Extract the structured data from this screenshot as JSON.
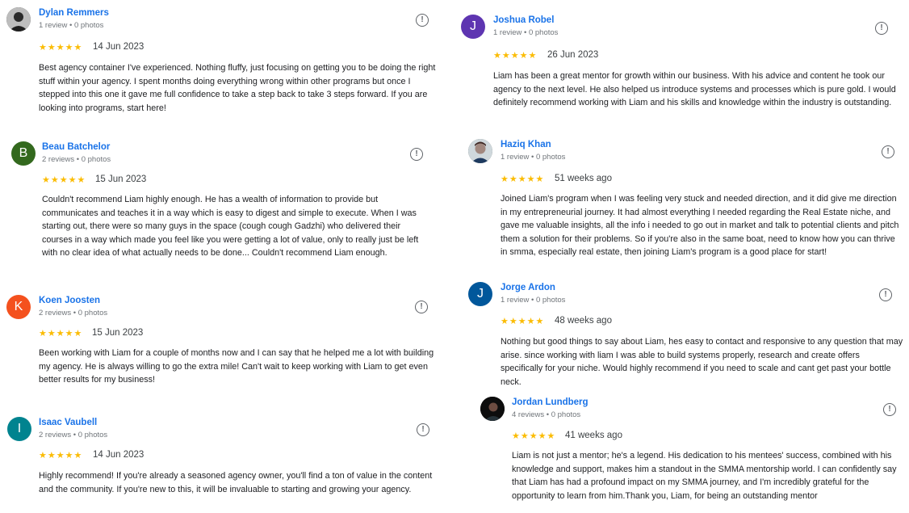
{
  "colors": {
    "link": "#1a73e8",
    "star": "#fbbc04",
    "meta": "#70757a"
  },
  "left": [
    {
      "name": "Dylan Remmers",
      "meta": "1 review • 0 photos",
      "initial": "",
      "avatar_color": "#4a4a4a",
      "rating": 5,
      "stars": "★★★★★",
      "date": "14 Jun 2023",
      "text": "Best agency container I've experienced. Nothing fluffy, just focusing on getting you to be doing the right stuff within your agency. I spent months doing everything wrong within other programs but once I stepped into this one it gave me full confidence to take a step back to take 3 steps forward. If you are looking into programs, start here!"
    },
    {
      "name": "Beau Batchelor",
      "meta": "2 reviews • 0 photos",
      "initial": "B",
      "avatar_color": "#33691e",
      "rating": 5,
      "stars": "★★★★★",
      "date": "15 Jun 2023",
      "text": "Couldn't recommend Liam highly enough. He has a wealth of information to provide but communicates and teaches it in a way which is easy to digest and simple to execute. When I was starting out, there were so many guys in the space (cough cough Gadzhi) who delivered their courses in a way which made you feel like you were getting a lot of value, only to really just be left with no clear idea of what actually needs to be done... Couldn't recommend Liam enough."
    },
    {
      "name": "Koen Joosten",
      "meta": "2 reviews • 0 photos",
      "initial": "K",
      "avatar_color": "#f4511e",
      "rating": 5,
      "stars": "★★★★★",
      "date": "15 Jun 2023",
      "text": "Been working with Liam for a couple of months now and I can say that he helped me a lot with building my agency. He is always willing to go the extra mile! Can't wait to keep working with Liam to get even better results for my business!"
    },
    {
      "name": "Isaac Vaubell",
      "meta": "2 reviews • 0 photos",
      "initial": "I",
      "avatar_color": "#00838f",
      "rating": 5,
      "stars": "★★★★★",
      "date": "14 Jun 2023",
      "text": "Highly recommend! If you're already a seasoned agency owner, you'll find a ton of value in the content and the community. If you're new to this, it will be invaluable to starting and growing your agency."
    }
  ],
  "right": [
    {
      "name": "Joshua Robel",
      "meta": "1 review • 0 photos",
      "initial": "J",
      "avatar_color": "#5e35b1",
      "rating": 5,
      "stars": "★★★★★",
      "date": "26 Jun 2023",
      "text": "Liam has been a great mentor for growth within our business. With his advice and content he took our agency to the next level. He also helped us introduce systems and processes which is pure gold. I would definitely recommend working with Liam and his skills and knowledge within the industry is outstanding."
    },
    {
      "name": "Haziq Khan",
      "meta": "1 review • 0 photos",
      "initial": "",
      "avatar_color": "#8d6e63",
      "rating": 5,
      "stars": "★★★★★",
      "date": "51 weeks ago",
      "text": "Joined Liam's program when I was feeling very stuck and needed direction, and it did give me direction in my entrepreneurial journey. It had almost everything I needed regarding the Real Estate niche, and gave me valuable insights, all the info i needed to go out in market and talk to potential clients and pitch them a solution for their problems. So if you're also in the same boat, need to know how you can thrive in smma, especially real estate, then joining Liam's program is a good place for start!"
    },
    {
      "name": "Jorge Ardon",
      "meta": "1 review • 0 photos",
      "initial": "J",
      "avatar_color": "#01579b",
      "rating": 5,
      "stars": "★★★★★",
      "date": "48 weeks ago",
      "text": "Nothing but good things to say about Liam, hes easy to contact and responsive to any question that may arise. since working with liam I was able to build systems properly, research and create offers specifically for your niche. Would highly recommend if you need to scale and cant get past your bottle neck."
    },
    {
      "name": "Jordan Lundberg",
      "meta": "4 reviews • 0 photos",
      "initial": "",
      "avatar_color": "#111111",
      "rating": 5,
      "stars": "★★★★★",
      "date": "41 weeks ago",
      "text": "Liam is not just a mentor; he's a legend. His dedication to his mentees' success, combined with his knowledge and support, makes him a standout in the SMMA mentorship world. I can confidently say that Liam has had a profound impact on my SMMA journey, and I'm incredibly grateful for the opportunity to learn from him.Thank you, Liam, for being an outstanding mentor"
    }
  ],
  "report_glyph": "!"
}
